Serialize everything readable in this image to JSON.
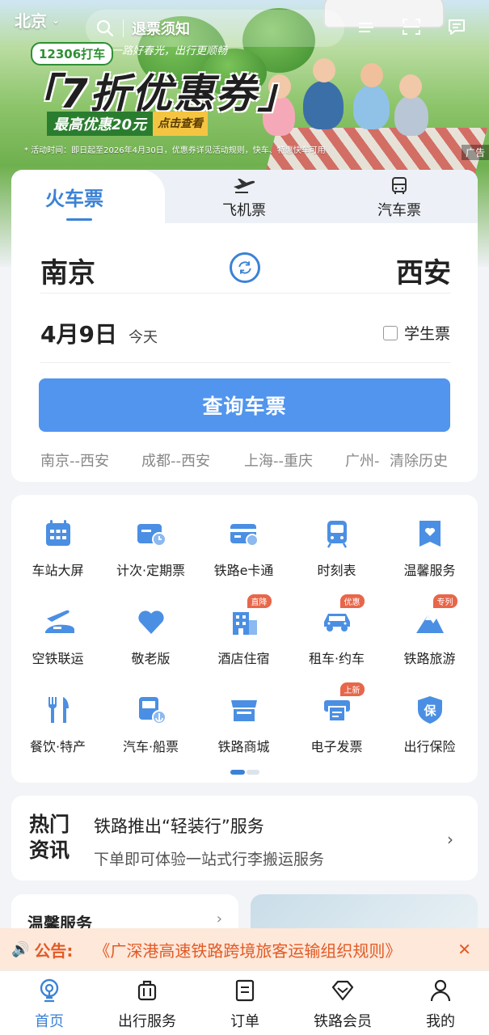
{
  "header": {
    "city": "北京",
    "search_text": "退票须知"
  },
  "banner": {
    "tag": "12306打车",
    "slogan": "一路好春光，出行更顺畅",
    "headline": "「7折优惠券」",
    "sub_left": "最高优惠20元",
    "sub_right": "点击查看",
    "note": "* 活动时间：即日起至2026年4月30日，优惠券详见活动规则，快车、特惠快车可用",
    "ad_label": "广告"
  },
  "booking": {
    "tabs": [
      {
        "label": "火车票",
        "icon": "train"
      },
      {
        "label": "飞机票",
        "icon": "plane-icon"
      },
      {
        "label": "汽车票",
        "icon": "bus-icon"
      }
    ],
    "from": "南京",
    "to": "西安",
    "date": "4月9日",
    "date_note": "今天",
    "student_label": "学生票",
    "query_button": "查询车票",
    "history": [
      "南京--西安",
      "成都--西安",
      "上海--重庆",
      "广州-"
    ],
    "clear_history": "清除历史"
  },
  "services": [
    {
      "label": "车站大屏",
      "icon": "calendar-board-icon"
    },
    {
      "label": "计次·定期票",
      "icon": "ticket-clock-icon"
    },
    {
      "label": "铁路e卡通",
      "icon": "card-icon"
    },
    {
      "label": "时刻表",
      "icon": "train-front-icon"
    },
    {
      "label": "温馨服务",
      "icon": "heart-ribbon-icon"
    },
    {
      "label": "空铁联运",
      "icon": "plane-train-icon"
    },
    {
      "label": "敬老版",
      "icon": "heart-icon"
    },
    {
      "label": "酒店住宿",
      "icon": "hotel-icon",
      "badge": "直降"
    },
    {
      "label": "租车·约车",
      "icon": "car-icon",
      "badge": "优惠"
    },
    {
      "label": "铁路旅游",
      "icon": "mountain-icon",
      "badge": "专列"
    },
    {
      "label": "餐饮·特产",
      "icon": "fork-knife-icon"
    },
    {
      "label": "汽车·船票",
      "icon": "bus-anchor-icon"
    },
    {
      "label": "铁路商城",
      "icon": "shop-icon"
    },
    {
      "label": "电子发票",
      "icon": "printer-icon",
      "badge": "上新"
    },
    {
      "label": "出行保险",
      "icon": "shield-icon",
      "shield_text": "保"
    }
  ],
  "news": {
    "tag": "热门资讯",
    "title": "铁路推出“轻装行”服务",
    "subtitle": "下单即可体验一站式行李搬运服务"
  },
  "warm_service": {
    "title": "温馨服务"
  },
  "notice": {
    "label": "公告:",
    "text": "《广深港高速铁路跨境旅客运输组织规则》"
  },
  "nav": [
    {
      "label": "首页",
      "icon": "home-icon",
      "active": true
    },
    {
      "label": "出行服务",
      "icon": "luggage-icon"
    },
    {
      "label": "订单",
      "icon": "order-icon"
    },
    {
      "label": "铁路会员",
      "icon": "diamond-icon"
    },
    {
      "label": "我的",
      "icon": "user-icon"
    }
  ],
  "colors": {
    "accent": "#3b82d6",
    "button": "#5195ee",
    "notice": "#e35a25",
    "badge": "#e8664a"
  }
}
